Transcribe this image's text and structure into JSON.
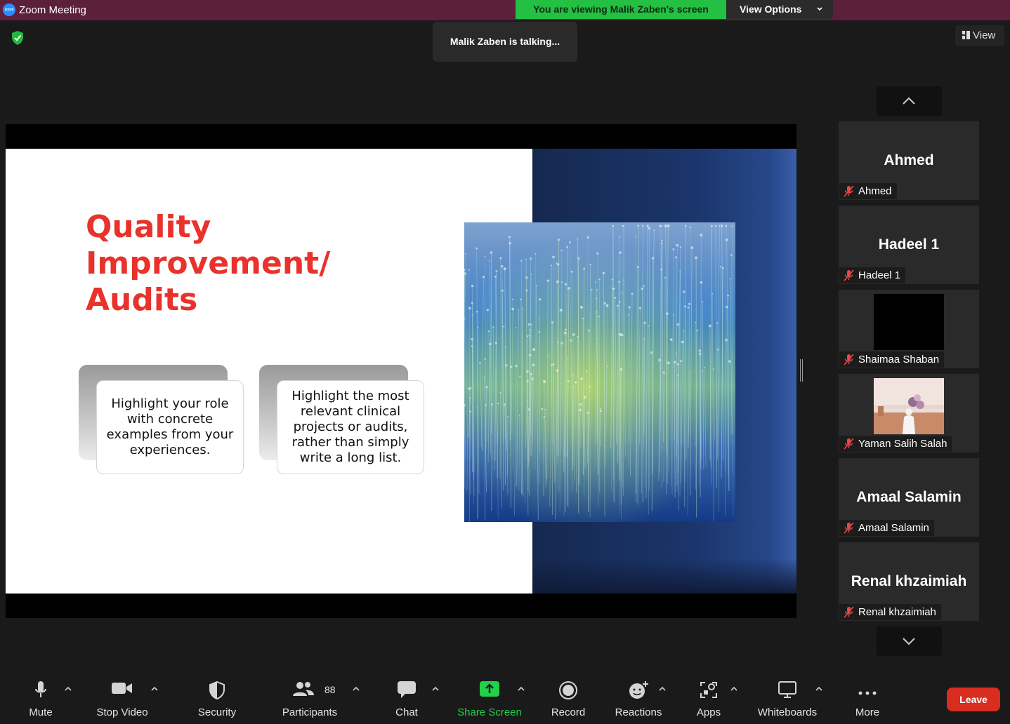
{
  "window": {
    "title": "Zoom Meeting",
    "app_icon_text": "zoom"
  },
  "banner": {
    "viewing_text": "You are viewing Malik Zaben's screen",
    "view_options_label": "View Options"
  },
  "talking_indicator": "Malik Zaben is talking...",
  "view_button_label": "View",
  "slide": {
    "title_line1": "Quality",
    "title_line2": "Improvement/ Audits",
    "card1_text": "Highlight your role with concrete examples from your experiences.",
    "card2_text": "Highlight the most relevant clinical projects or audits, rather than simply write a long list.",
    "title_color": "#e8322b"
  },
  "participants_gallery": [
    {
      "display_name": "Ahmed",
      "label": "Ahmed",
      "muted": true,
      "video": "off"
    },
    {
      "display_name": "Hadeel 1",
      "label": "Hadeel 1",
      "muted": true,
      "video": "off"
    },
    {
      "display_name": "",
      "label": "Shaimaa Shaban",
      "muted": true,
      "video": "black"
    },
    {
      "display_name": "",
      "label": "Yaman Salih Salah",
      "muted": true,
      "video": "photo"
    },
    {
      "display_name": "Amaal Salamin",
      "label": "Amaal Salamin",
      "muted": true,
      "video": "off"
    },
    {
      "display_name": "Renal khzaimiah",
      "label": "Renal khzaimiah",
      "muted": true,
      "video": "off"
    }
  ],
  "toolbar": {
    "mute": "Mute",
    "stop_video": "Stop Video",
    "security": "Security",
    "participants": "Participants",
    "participants_count": "88",
    "chat": "Chat",
    "share_screen": "Share Screen",
    "record": "Record",
    "reactions": "Reactions",
    "apps": "Apps",
    "whiteboards": "Whiteboards",
    "more": "More",
    "leave": "Leave"
  },
  "colors": {
    "title_bar": "#5c1f3c",
    "viewing_banner": "#23c043",
    "share_screen_accent": "#22d04a",
    "leave_button": "#d92d20",
    "muted_icon": "#e5484d"
  }
}
